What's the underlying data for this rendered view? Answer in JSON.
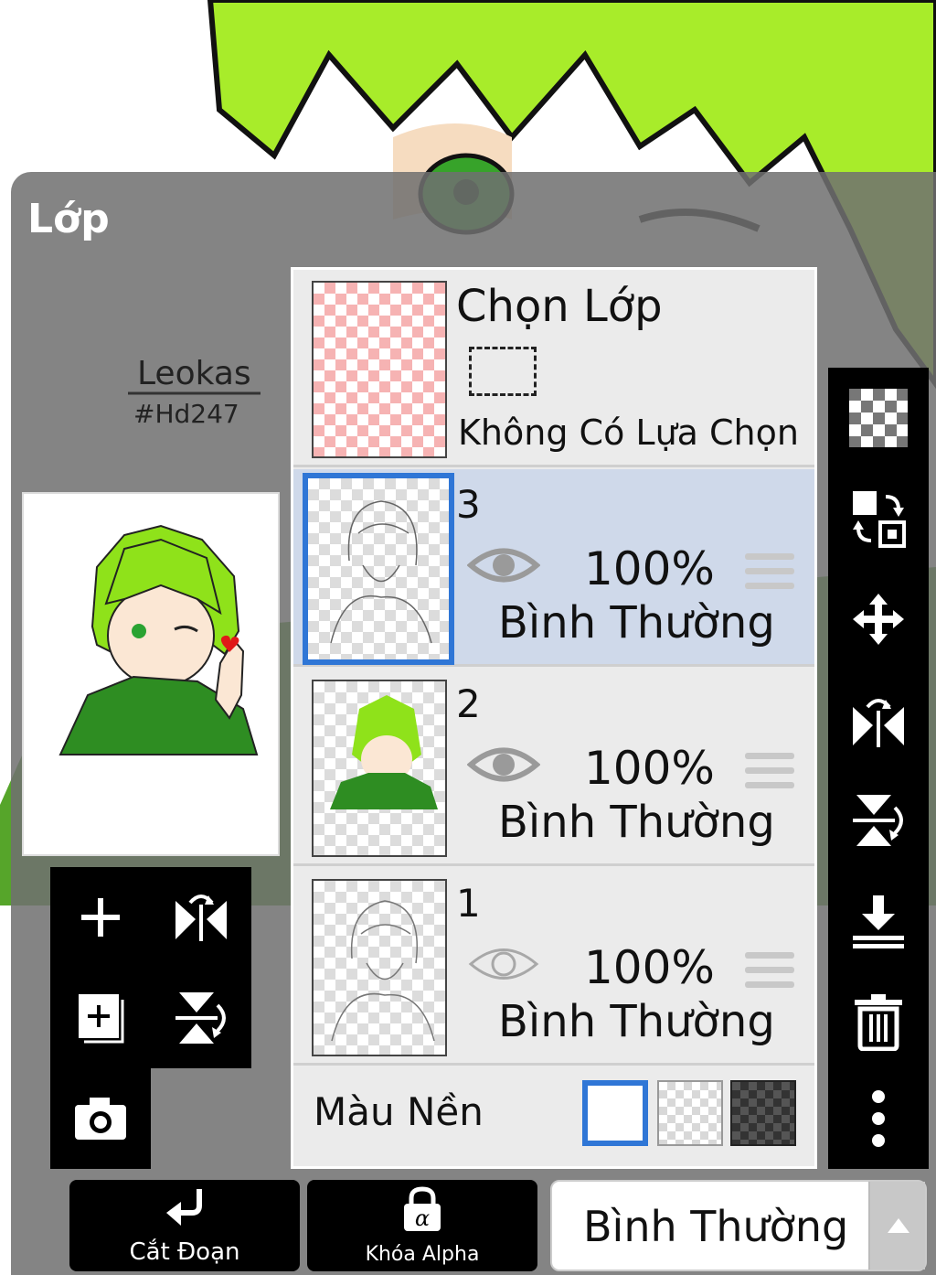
{
  "panel": {
    "title": "Lớp"
  },
  "signature": {
    "name": "Leokas",
    "tag": "#Hd247"
  },
  "selection_layer": {
    "title": "Chọn Lớp",
    "status": "Không Có Lựa Chọn"
  },
  "layers": [
    {
      "number": "3",
      "opacity": "100%",
      "blend": "Bình Thường",
      "selected": true,
      "visible": true
    },
    {
      "number": "2",
      "opacity": "100%",
      "blend": "Bình Thường",
      "selected": false,
      "visible": true
    },
    {
      "number": "1",
      "opacity": "100%",
      "blend": "Bình Thường",
      "selected": false,
      "visible": false
    }
  ],
  "background": {
    "label": "Màu Nền",
    "options": [
      "white",
      "transparent",
      "dark"
    ],
    "selected": "white"
  },
  "left_tools": [
    "add-layer-icon",
    "flip-horizontal-icon",
    "add-layer-copy-icon",
    "flip-vertical-icon",
    "camera-icon"
  ],
  "right_tools": [
    "transparency-icon",
    "swap-layers-icon",
    "move-icon",
    "flip-horizontal-icon",
    "flip-vertical-icon",
    "merge-down-icon",
    "trash-icon",
    "more-icon"
  ],
  "bottom": {
    "clip_label": "Cắt Đoạn",
    "alpha_lock_label": "Khóa Alpha",
    "blend_mode": "Bình Thường"
  },
  "colors": {
    "accent": "#2f76d6",
    "hair": "#9be01c",
    "selected_row": "#cfd9ea"
  }
}
